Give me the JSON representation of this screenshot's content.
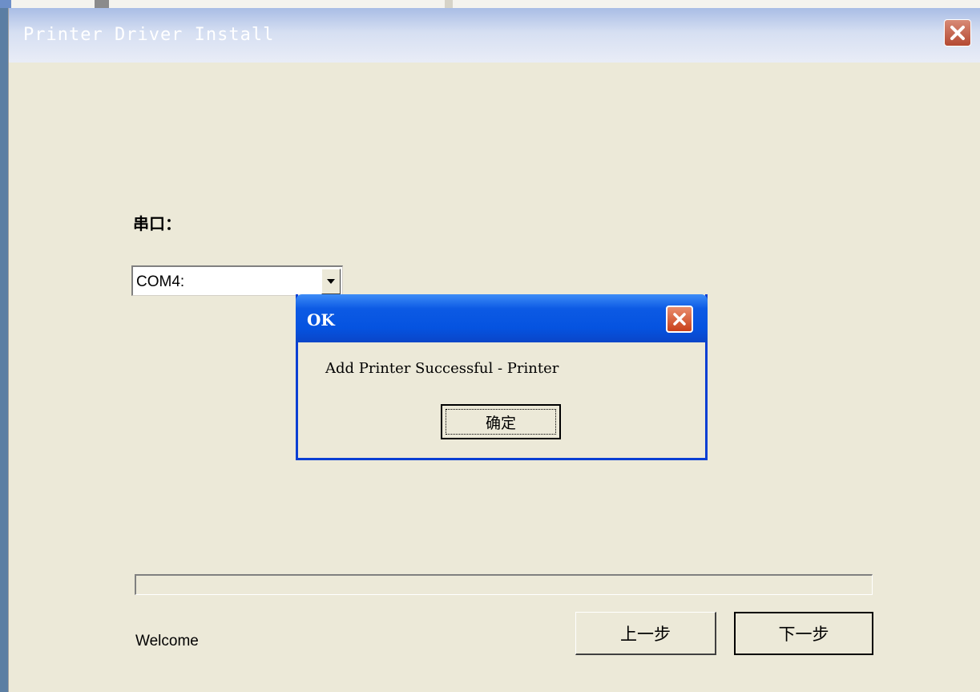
{
  "window": {
    "title": "Printer Driver Install"
  },
  "form": {
    "port_label": "串口：",
    "port_value": "COM4:"
  },
  "footer": {
    "status": "Welcome",
    "progress": 0,
    "prev_label": "上一步",
    "next_label": "下一步"
  },
  "dialog": {
    "title": "OK",
    "message": "Add Printer Successful - Printer",
    "ok_label": "确定"
  },
  "colors": {
    "dialog_title_blue": "#0553e0",
    "close_red": "#c8401a",
    "face": "#ece9d8"
  },
  "icons": {
    "window_close": "close-icon",
    "dialog_close": "close-icon",
    "dropdown": "chevron-down-icon"
  }
}
